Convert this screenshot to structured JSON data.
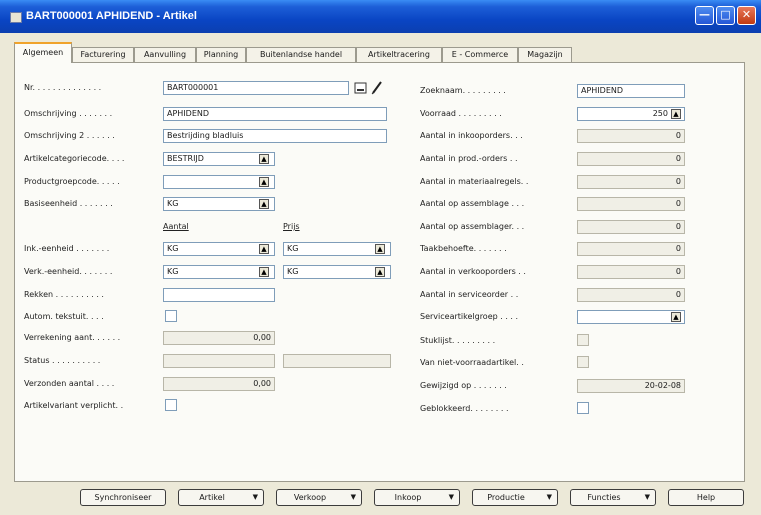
{
  "window": {
    "title": "BART000001 APHIDEND - Artikel"
  },
  "tabs": [
    {
      "label": "Algemeen",
      "active": true
    },
    {
      "label": "Facturering"
    },
    {
      "label": "Aanvulling"
    },
    {
      "label": "Planning"
    },
    {
      "label": "Buitenlandse handel"
    },
    {
      "label": "Artikeltracering"
    },
    {
      "label": "E - Commerce"
    },
    {
      "label": "Magazijn"
    }
  ],
  "left": {
    "nr": {
      "label": "Nr. . . . . . . . . . . . . .",
      "value": "BART000001"
    },
    "omschrijving": {
      "label": "Omschrijving . . . . . . .",
      "value": "APHIDEND"
    },
    "omschrijving2": {
      "label": "Omschrijving 2 . . . . . .",
      "value": "Bestrijding bladluis"
    },
    "artikelcategorie": {
      "label": "Artikelcategoriecode. . . .",
      "value": "BESTRIJD"
    },
    "productgroep": {
      "label": "Productgroepcode. . . . .",
      "value": ""
    },
    "basiseenheid": {
      "label": "Basiseenheid . . . . . . .",
      "value": "KG"
    },
    "col_aantal": "Aantal",
    "col_prijs": "Prijs",
    "ink_eenheid": {
      "label": "Ink.-eenheid . . . . . . .",
      "value_aantal": "KG",
      "value_prijs": "KG"
    },
    "verk_eenheid": {
      "label": "Verk.-eenheid. . . . . . .",
      "value_aantal": "KG",
      "value_prijs": "KG"
    },
    "rekken": {
      "label": "Rekken . . . . . . . . . .",
      "value": ""
    },
    "auton_tekstuit": {
      "label": "Autom. tekstuit. . . .",
      "checked": false
    },
    "verrekening_aant": {
      "label": "Verrekening aant. . . . . .",
      "value": "0,00"
    },
    "status": {
      "label": "Status . . . . . . . . . .",
      "value": "",
      "value2": ""
    },
    "verzonden_aantal": {
      "label": "Verzonden aantal . . . .",
      "value": "0,00"
    },
    "artikelvariant": {
      "label": "Artikelvariant verplicht. .",
      "checked": false
    }
  },
  "right": {
    "zoeknaam": {
      "label": "Zoeknaam. . . . . . . . .",
      "value": "APHIDEND"
    },
    "voorraad": {
      "label": "Voorraad . . . . . . . . .",
      "value": "250"
    },
    "inkooporders": {
      "label": "Aantal in inkooporders. . .",
      "value": "0"
    },
    "prod_orders": {
      "label": "Aantal in prod.-orders . .",
      "value": "0"
    },
    "materiaalregels": {
      "label": "Aantal in materiaalregels. .",
      "value": "0"
    },
    "assemblage1": {
      "label": "Aantal op assemblage . . .",
      "value": "0"
    },
    "assemblage2": {
      "label": "Aantal op assemblager. . .",
      "value": "0"
    },
    "taakbehoefte": {
      "label": "Taakbehoefte. . . . . . .",
      "value": "0"
    },
    "verkooporders": {
      "label": "Aantal in verkooporders . .",
      "value": "0"
    },
    "serviceorder": {
      "label": "Aantal in serviceorder . .",
      "value": "0"
    },
    "serviceartikelgroep": {
      "label": "Serviceartikelgroep . . . .",
      "value": ""
    },
    "stuklijst": {
      "label": "Stuklijst. . . . . . . . .",
      "checked": false
    },
    "niet_voorraad": {
      "label": "Van niet-voorraadartikel. .",
      "checked": false
    },
    "gewijzigd_op": {
      "label": "Gewijzigd op . . . . . . .",
      "value": "20-02-08"
    },
    "geblokkeerd": {
      "label": "Geblokkeerd. . . . . . . .",
      "checked": false
    }
  },
  "buttons": {
    "synchroniseer": "Synchroniseer",
    "artikel": "Artikel",
    "verkoop": "Verkoop",
    "inkoop": "Inkoop",
    "productie": "Productie",
    "functies": "Functies",
    "help": "Help"
  },
  "colors": {
    "titlebar": "#0a45c4",
    "window_bg": "#ece9d8",
    "panel_bg": "#fbfbf7",
    "tab_highlight": "#f0a32c",
    "field_border": "#7f9db9"
  }
}
